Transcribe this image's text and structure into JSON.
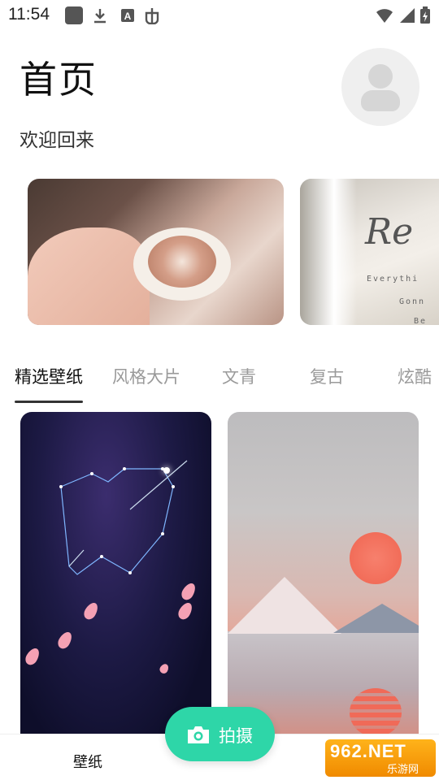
{
  "status_bar": {
    "time": "11:54",
    "icons": [
      "notification-square-icon",
      "download-icon",
      "font-a-icon",
      "bug-icon",
      "wifi-icon",
      "signal-icon",
      "battery-charging-icon"
    ]
  },
  "header": {
    "title": "首页",
    "welcome": "欢迎回来",
    "avatar_icon": "user-avatar-icon"
  },
  "banners": [
    {
      "name": "banner-coffee"
    },
    {
      "name": "banner-beach",
      "script_text": "Re",
      "line1": "Everythi",
      "line2": "Gonn",
      "line3": "Be"
    }
  ],
  "tabs": [
    {
      "label": "精选壁纸",
      "active": true
    },
    {
      "label": "风格大片",
      "active": false
    },
    {
      "label": "文青",
      "active": false
    },
    {
      "label": "复古",
      "active": false
    },
    {
      "label": "炫酷",
      "active": false
    }
  ],
  "cards": [
    {
      "name": "wallpaper-constellation-heart"
    },
    {
      "name": "wallpaper-sunset-mountain"
    }
  ],
  "bottom_nav": {
    "wallpaper_label": "壁纸",
    "fab_label": "拍摄",
    "fab_icon": "camera-icon"
  },
  "watermark": {
    "main": "962.NET",
    "sub": "乐游网"
  },
  "colors": {
    "accent": "#2ed6a8",
    "tab_active": "#111111",
    "tab_inactive": "#9a9a9a"
  }
}
